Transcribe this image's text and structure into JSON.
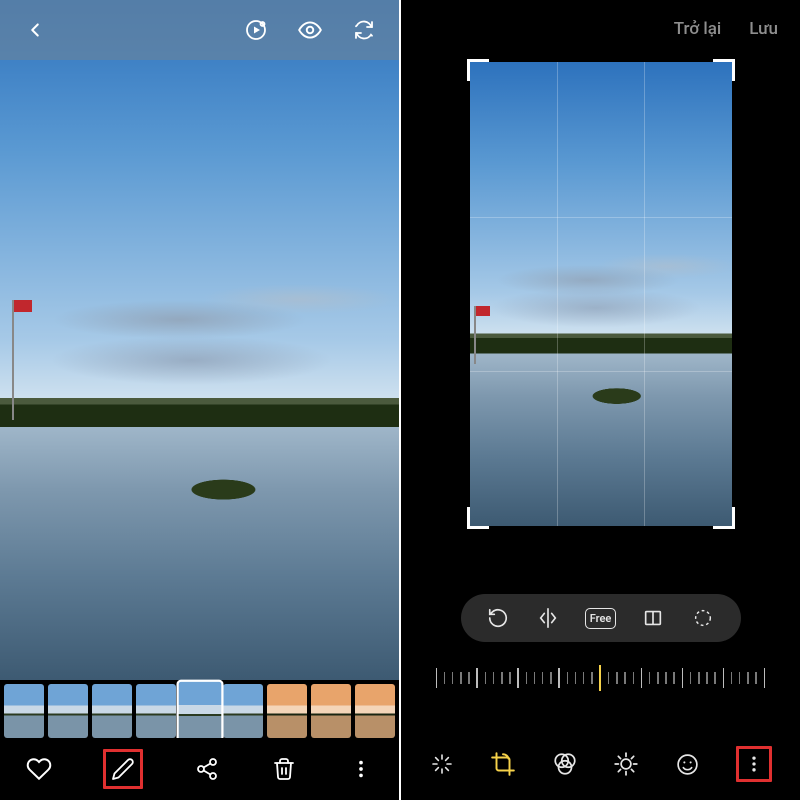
{
  "viewer": {
    "top_icons": {
      "back": "back-icon",
      "video": "video-play-icon",
      "view": "eye-icon",
      "refresh": "sync-icon"
    },
    "thumbnails": [
      "sky",
      "sky",
      "sky",
      "sky",
      "selected",
      "sky",
      "sunset",
      "sunset",
      "sunset"
    ],
    "bottom_icons": {
      "favorite": "heart-icon",
      "edit": "pencil-icon",
      "share": "share-icon",
      "delete": "trash-icon",
      "more": "more-vertical-icon"
    }
  },
  "editor": {
    "header": {
      "back_label": "Trở lại",
      "save_label": "Lưu"
    },
    "crop_tools": {
      "rotate": "rotate-icon",
      "flip": "flip-horizontal-icon",
      "ratio_label": "Free",
      "perspective": "perspective-icon",
      "lasso": "lasso-icon"
    },
    "bottom_tools": {
      "auto": "auto-magic-icon",
      "crop": "crop-rotate-icon",
      "filters": "filters-icon",
      "brightness": "brightness-icon",
      "sticker": "smiley-icon",
      "more": "more-vertical-icon"
    }
  }
}
